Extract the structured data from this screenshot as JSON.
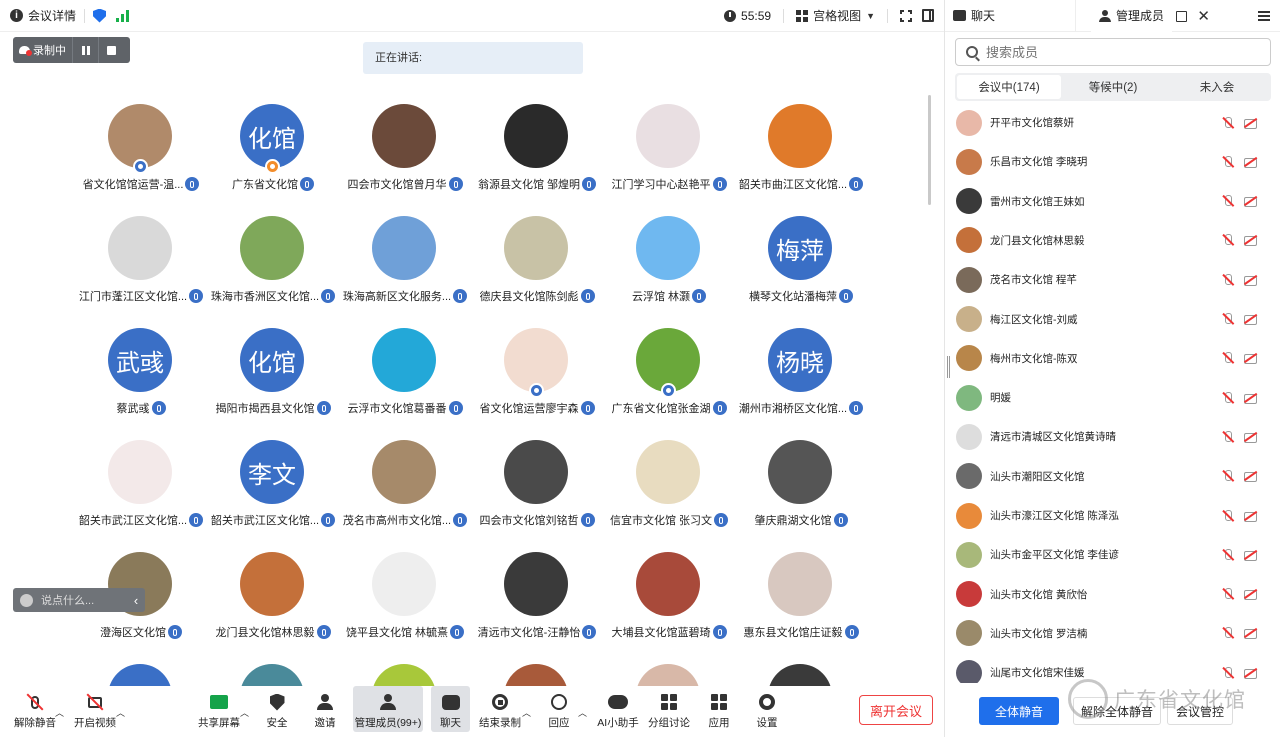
{
  "topbar": {
    "meeting_info": "会议详情",
    "timer": "55:59",
    "view_mode": "宫格视图"
  },
  "recording": {
    "label": "录制中"
  },
  "speaking": {
    "label": "正在讲话:"
  },
  "chat_input": {
    "placeholder": "说点什么..."
  },
  "participants_grid": [
    {
      "name": "省文化馆馆运营-温...",
      "initials": "",
      "color": "#b08a6a",
      "badge": "host"
    },
    {
      "name": "广东省文化馆",
      "initials": "化馆",
      "color": "#3a6fc6",
      "badge": "cohost"
    },
    {
      "name": "四会市文化馆曾月华",
      "initials": "",
      "color": "#6b4a3a",
      "badge": ""
    },
    {
      "name": "翁源县文化馆 邹煌明",
      "initials": "",
      "color": "#2a2a2a",
      "badge": ""
    },
    {
      "name": "江门学习中心赵艳平",
      "initials": "",
      "color": "#e9dfe2",
      "badge": ""
    },
    {
      "name": "韶关市曲江区文化馆...",
      "initials": "",
      "color": "#e07a2a",
      "badge": ""
    },
    {
      "name": "江门市蓬江区文化馆...",
      "initials": "",
      "color": "#d9d9d9",
      "badge": ""
    },
    {
      "name": "珠海市香洲区文化馆...",
      "initials": "",
      "color": "#7fa85a",
      "badge": ""
    },
    {
      "name": "珠海高新区文化服务...",
      "initials": "",
      "color": "#6fa0d8",
      "badge": ""
    },
    {
      "name": "德庆县文化馆陈剑彪",
      "initials": "",
      "color": "#c8c2a6",
      "badge": ""
    },
    {
      "name": "云浮馆 林灏",
      "initials": "",
      "color": "#6fb8f0",
      "badge": ""
    },
    {
      "name": "横琴文化站潘梅萍",
      "initials": "梅萍",
      "color": "#3a6fc6",
      "badge": ""
    },
    {
      "name": "蔡武彧",
      "initials": "武彧",
      "color": "#3a6fc6",
      "badge": ""
    },
    {
      "name": "揭阳市揭西县文化馆",
      "initials": "化馆",
      "color": "#3a6fc6",
      "badge": ""
    },
    {
      "name": "云浮市文化馆葛番番",
      "initials": "",
      "color": "#23a8d8",
      "badge": ""
    },
    {
      "name": "省文化馆运营廖宇森",
      "initials": "",
      "color": "#f2dcd0",
      "badge": "host"
    },
    {
      "name": "广东省文化馆张金湖",
      "initials": "",
      "color": "#6aa83a",
      "badge": "host"
    },
    {
      "name": "潮州市湘桥区文化馆...",
      "initials": "杨晓",
      "color": "#3a6fc6",
      "badge": ""
    },
    {
      "name": "韶关市武江区文化馆...",
      "initials": "",
      "color": "#f3e9e9",
      "badge": ""
    },
    {
      "name": "韶关市武江区文化馆...",
      "initials": "李文",
      "color": "#3a6fc6",
      "badge": ""
    },
    {
      "name": "茂名市高州市文化馆...",
      "initials": "",
      "color": "#a68a6a",
      "badge": ""
    },
    {
      "name": "四会市文化馆刘铭哲",
      "initials": "",
      "color": "#4a4a4a",
      "badge": ""
    },
    {
      "name": "信宜市文化馆 张习文",
      "initials": "",
      "color": "#e8dcc0",
      "badge": ""
    },
    {
      "name": "肇庆鼎湖文化馆",
      "initials": "",
      "color": "#555555",
      "badge": ""
    },
    {
      "name": "澄海区文化馆",
      "initials": "",
      "color": "#8a7a5a",
      "badge": ""
    },
    {
      "name": "龙门县文化馆林思毅",
      "initials": "",
      "color": "#c4703a",
      "badge": ""
    },
    {
      "name": "饶平县文化馆 林毓熹",
      "initials": "",
      "color": "#eeeeee",
      "badge": ""
    },
    {
      "name": "清远市文化馆-汪静怡",
      "initials": "",
      "color": "#3a3a3a",
      "badge": ""
    },
    {
      "name": "大埔县文化馆蓝碧琦",
      "initials": "",
      "color": "#a84a3a",
      "badge": ""
    },
    {
      "name": "惠东县文化馆庄证毅",
      "initials": "",
      "color": "#d8c8c0",
      "badge": ""
    }
  ],
  "toolbar": {
    "unmute": "解除静音",
    "start_video": "开启视频",
    "share_screen": "共享屏幕",
    "security": "安全",
    "invite": "邀请",
    "manage_members": "管理成员(99+)",
    "chat": "聊天",
    "end_recording": "结束录制",
    "reactions": "回应",
    "ai_assistant": "AI小助手",
    "breakout": "分组讨论",
    "apps": "应用",
    "settings": "设置",
    "leave": "离开会议"
  },
  "panel": {
    "tab_chat": "聊天",
    "tab_members": "管理成员",
    "search_placeholder": "搜索成员",
    "segments": [
      "会议中(174)",
      "等候中(2)",
      "未入会"
    ],
    "members": [
      {
        "name": "开平市文化馆蔡妍",
        "color": "#e8b8a8"
      },
      {
        "name": "乐昌市文化馆 李晓玥",
        "color": "#c87a4a"
      },
      {
        "name": "雷州市文化馆王妹如",
        "color": "#3a3a3a"
      },
      {
        "name": "龙门县文化馆林思毅",
        "color": "#c4703a"
      },
      {
        "name": "茂名市文化馆 程芊",
        "color": "#7a6a5a"
      },
      {
        "name": "梅江区文化馆-刘威",
        "color": "#c8b08a"
      },
      {
        "name": "梅州市文化馆-陈双",
        "color": "#b8864a"
      },
      {
        "name": "明媛",
        "color": "#7fb87f"
      },
      {
        "name": "清远市清城区文化馆黄诗晴",
        "color": "#dddddd"
      },
      {
        "name": "汕头市潮阳区文化馆",
        "color": "#6a6a6a"
      },
      {
        "name": "汕头市濠江区文化馆 陈泽泓",
        "color": "#e88a3a"
      },
      {
        "name": "汕头市金平区文化馆 李佳谚",
        "color": "#a8b87a"
      },
      {
        "name": "汕头市文化馆 黄欣怡",
        "color": "#c83a3a"
      },
      {
        "name": "汕头市文化馆 罗洁楠",
        "color": "#9a8a6a"
      },
      {
        "name": "汕尾市文化馆宋佳媛",
        "color": "#5a5a6a"
      }
    ],
    "mute_all": "全体静音",
    "unmute_all": "解除全体静音",
    "meeting_control": "会议管控"
  },
  "watermark": {
    "text": "广东省文化馆"
  }
}
